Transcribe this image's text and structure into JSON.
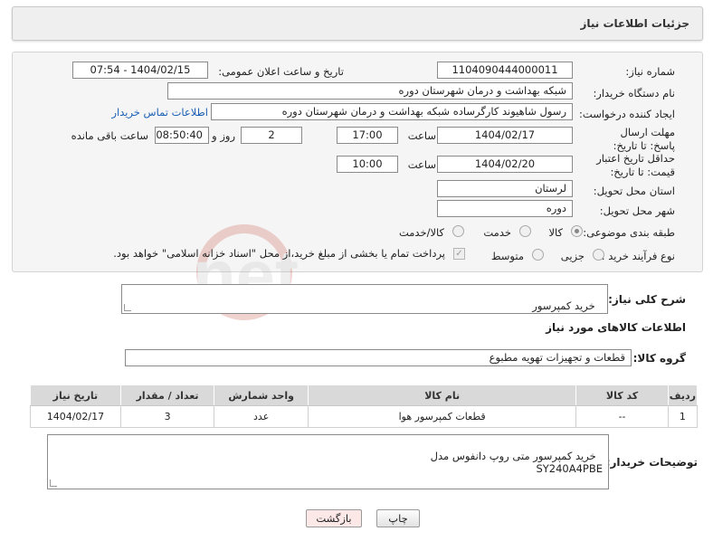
{
  "header": {
    "title": "جزئیات اطلاعات نیاز"
  },
  "form": {
    "need_number_label": "شماره نیاز:",
    "need_number": "1104090444000011",
    "announce_label": "تاریخ و ساعت اعلان عمومی:",
    "announce_value": "1404/02/15 - 07:54",
    "buyer_org_label": "نام دستگاه خریدار:",
    "buyer_org": "شبکه بهداشت و درمان شهرستان دوره",
    "requester_label": "ایجاد کننده درخواست:",
    "requester": "رسول شاهیوند کارگرساده شبکه بهداشت و درمان شهرستان دوره",
    "contact_link": "اطلاعات تماس خریدار",
    "reply_deadline_label": "مهلت ارسال پاسخ: تا تاریخ:",
    "reply_date": "1404/02/17",
    "time_label": "ساعت",
    "reply_time": "17:00",
    "days_value": "2",
    "days_label": "روز و",
    "remaining_time": "08:50:40",
    "remaining_label": "ساعت باقی مانده",
    "price_validity_label": "حداقل تاریخ اعتبار قیمت: تا تاریخ:",
    "price_date": "1404/02/20",
    "price_time": "10:00",
    "province_label": "استان محل تحویل:",
    "province": "لرستان",
    "city_label": "شهر محل تحویل:",
    "city": "دوره",
    "category_label": "طبقه بندی موضوعی:",
    "category_options": [
      "کالا",
      "خدمت",
      "کالا/خدمت"
    ],
    "category_selected": "کالا",
    "process_label": "نوع فرآیند خرید :",
    "process_options": [
      "جزیی",
      "متوسط"
    ],
    "payment_note": "پرداخت تمام یا بخشی از مبلغ خرید،از محل \"اسناد خزانه اسلامی\" خواهد بود."
  },
  "description": {
    "label": "شرح کلی نیاز:",
    "value": "خرید کمپرسور"
  },
  "goods_section": {
    "title": "اطلاعات کالاهای مورد نیاز",
    "group_label": "گروه کالا:",
    "group_value": "قطعات و تجهیزات تهویه مطبوع"
  },
  "table": {
    "headers": [
      "ردیف",
      "کد کالا",
      "نام کالا",
      "واحد شمارش",
      "تعداد / مقدار",
      "تاریخ نیاز"
    ],
    "rows": [
      [
        "1",
        "--",
        "قطعات کمپرسور هوا",
        "عدد",
        "3",
        "1404/02/17"
      ]
    ]
  },
  "buyer_notes": {
    "label": "توضیحات خریدار:",
    "value": "خرید کمپرسور متی روپ دانفوس مدل\nSY240A4PBE"
  },
  "buttons": {
    "print": "چاپ",
    "back": "بازگشت"
  },
  "watermark_text": "AriaTender.net",
  "colors": {
    "link": "#1a5fb4",
    "back_button_bg": "#fde8e8"
  }
}
